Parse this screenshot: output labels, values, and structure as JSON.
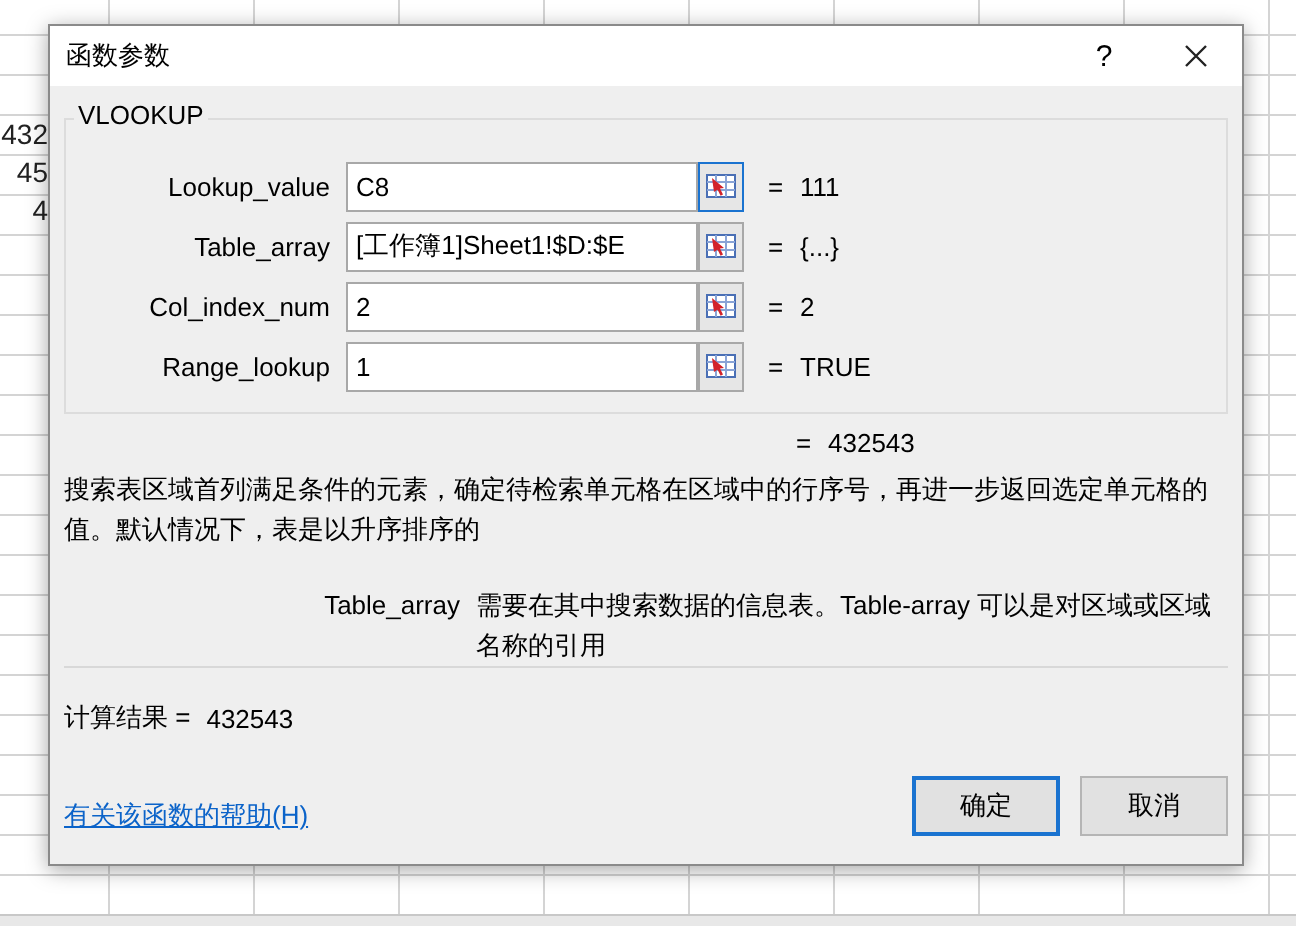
{
  "sheet": {
    "cells": [
      "432",
      "45",
      "4"
    ]
  },
  "dialog": {
    "title": "函数参数",
    "help_button": "?",
    "function_name": "VLOOKUP",
    "arguments": [
      {
        "label": "Lookup_value",
        "value": "C8",
        "equals": "=",
        "result": "111",
        "focused": true
      },
      {
        "label": "Table_array",
        "value": "[工作簿1]Sheet1!$D:$E",
        "equals": "=",
        "result": "{...}",
        "focused": false
      },
      {
        "label": "Col_index_num",
        "value": "2",
        "equals": "=",
        "result": "2",
        "focused": false
      },
      {
        "label": "Range_lookup",
        "value": "1",
        "equals": "=",
        "result": "TRUE",
        "focused": false
      }
    ],
    "formula_result": {
      "equals": "=",
      "value": "432543"
    },
    "description": "搜索表区域首列满足条件的元素，确定待检索单元格在区域中的行序号，再进一步返回选定单元格的值。默认情况下，表是以升序排序的",
    "argument_help": {
      "name": "Table_array",
      "text": "需要在其中搜索数据的信息表。Table-array 可以是对区域或区域名称的引用"
    },
    "calc_result": {
      "label": "计算结果 =",
      "value": "432543"
    },
    "help_link": "有关该函数的帮助(H)",
    "buttons": [
      {
        "label": "确定",
        "default": true
      },
      {
        "label": "取消",
        "default": false
      }
    ]
  }
}
